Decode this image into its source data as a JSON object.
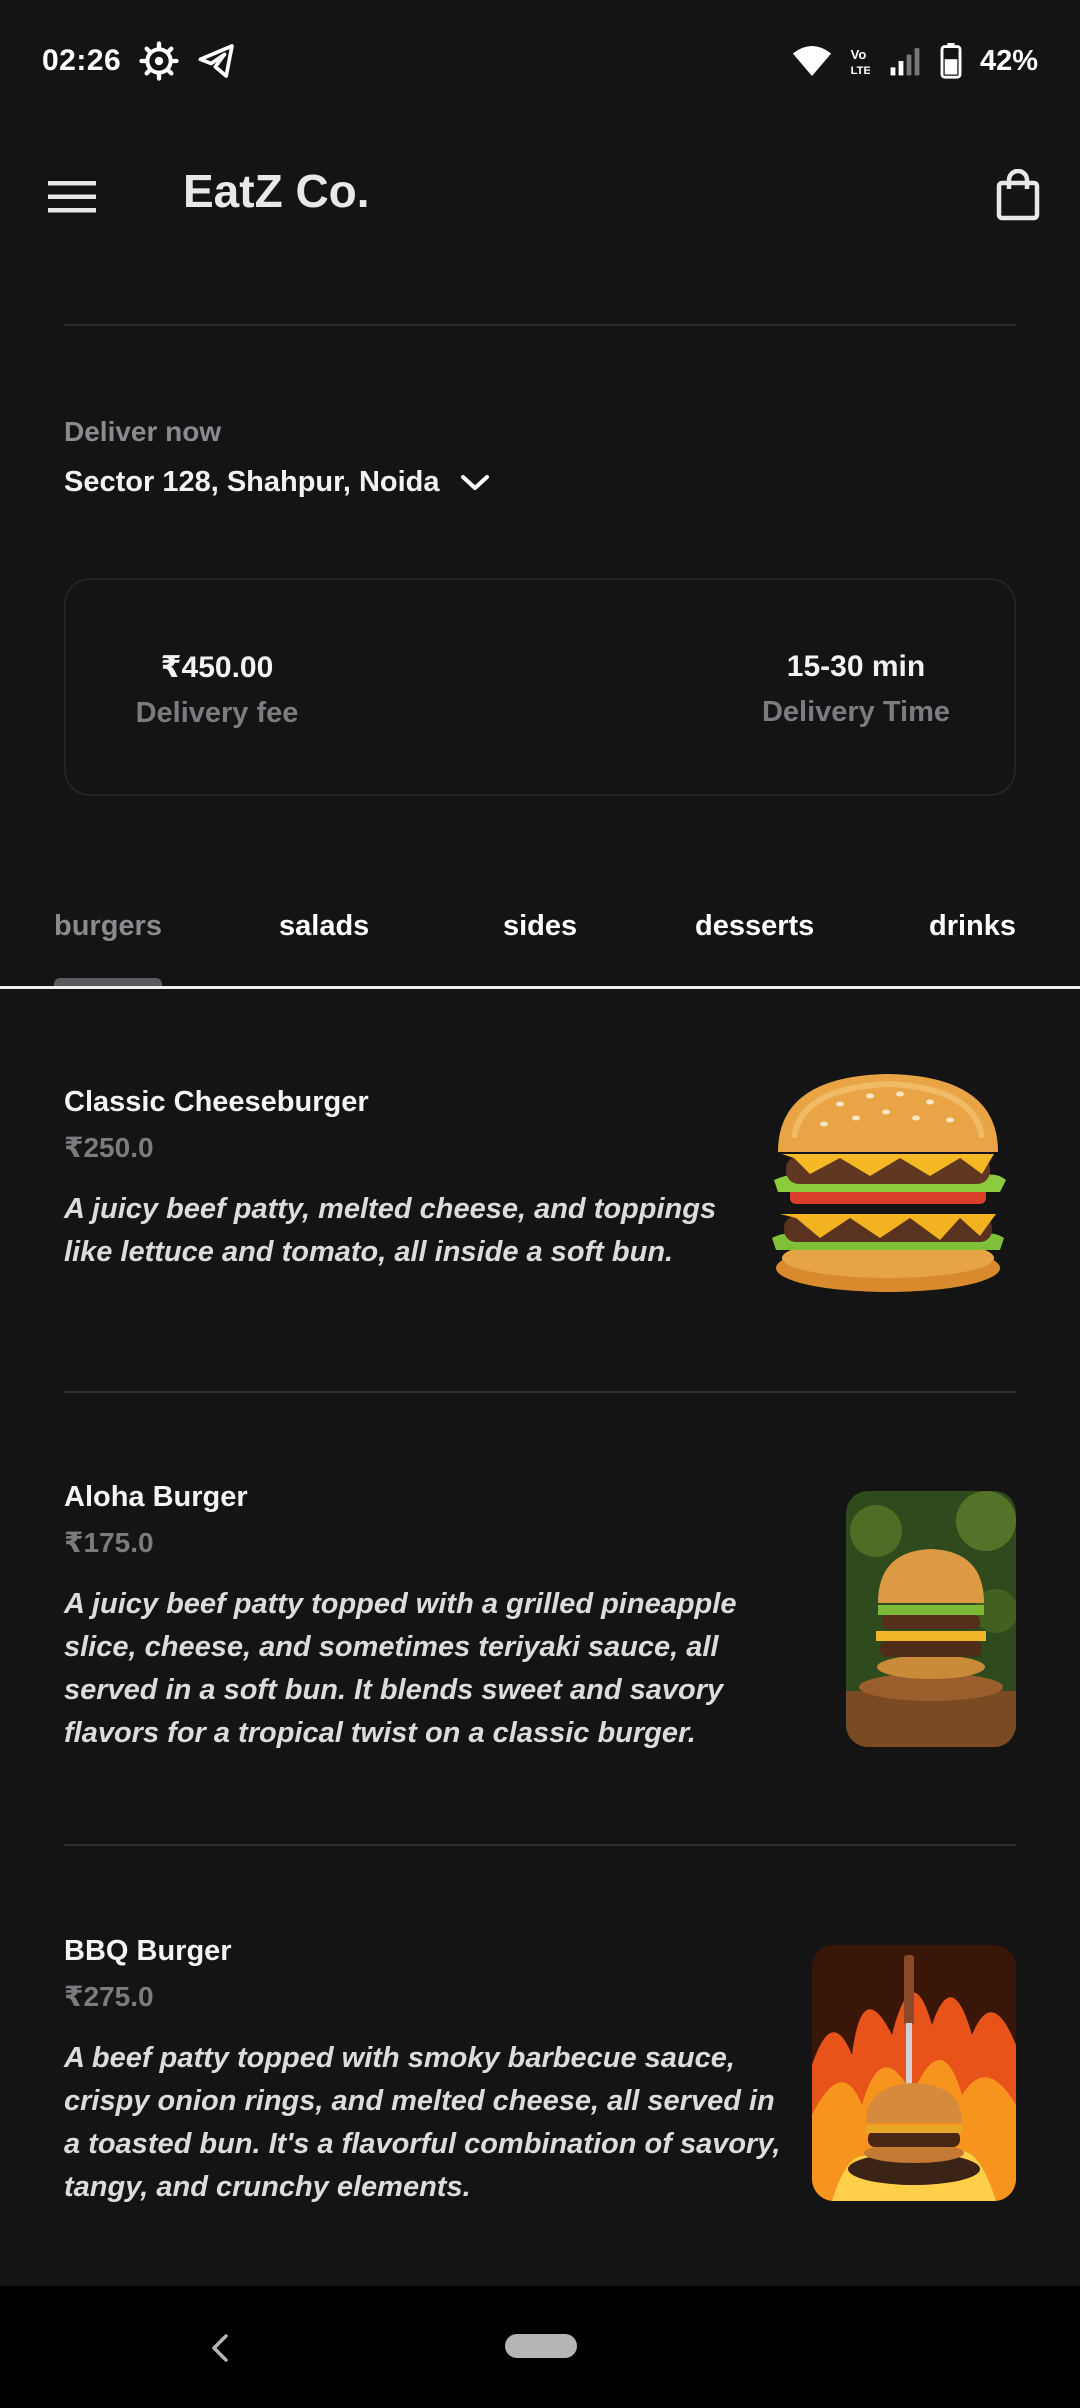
{
  "status_bar": {
    "time": "02:26",
    "battery_percent": "42%",
    "icons": [
      "settings-gear-icon",
      "telegram-icon",
      "wifi-icon",
      "volte-icon",
      "signal-icon",
      "battery-icon"
    ]
  },
  "app_bar": {
    "title": "EatZ Co.",
    "menu_icon": "hamburger-menu-icon",
    "cart_icon": "shopping-bag-icon"
  },
  "delivery": {
    "label": "Deliver now",
    "address": "Sector 128, Shahpur, Noida"
  },
  "info_card": {
    "fee_value": "₹450.00",
    "fee_label": "Delivery fee",
    "time_value": "15-30 min",
    "time_label": "Delivery Time"
  },
  "tabs": [
    {
      "label": "burgers",
      "active": true
    },
    {
      "label": "salads",
      "active": false
    },
    {
      "label": "sides",
      "active": false
    },
    {
      "label": "desserts",
      "active": false
    },
    {
      "label": "drinks",
      "active": false
    }
  ],
  "items": [
    {
      "name": "Classic Cheeseburger",
      "price": "₹250.0",
      "description": "A juicy beef patty, melted cheese, and toppings like lettuce and tomato, all inside a soft bun."
    },
    {
      "name": "Aloha Burger",
      "price": "₹175.0",
      "description": "A juicy beef patty topped with a grilled pineapple slice, cheese, and sometimes teriyaki sauce, all served in a soft bun. It blends sweet and savory flavors for a tropical twist on a classic burger."
    },
    {
      "name": "BBQ Burger",
      "price": "₹275.0",
      "description": "A beef patty topped with smoky barbecue sauce, crispy onion rings, and melted cheese, all served in a toasted bun. It's a flavorful combination of savory, tangy, and crunchy elements."
    }
  ],
  "colors": {
    "background": "#141415",
    "muted_text": "#7c7c80",
    "divider": "#2e2e30"
  }
}
